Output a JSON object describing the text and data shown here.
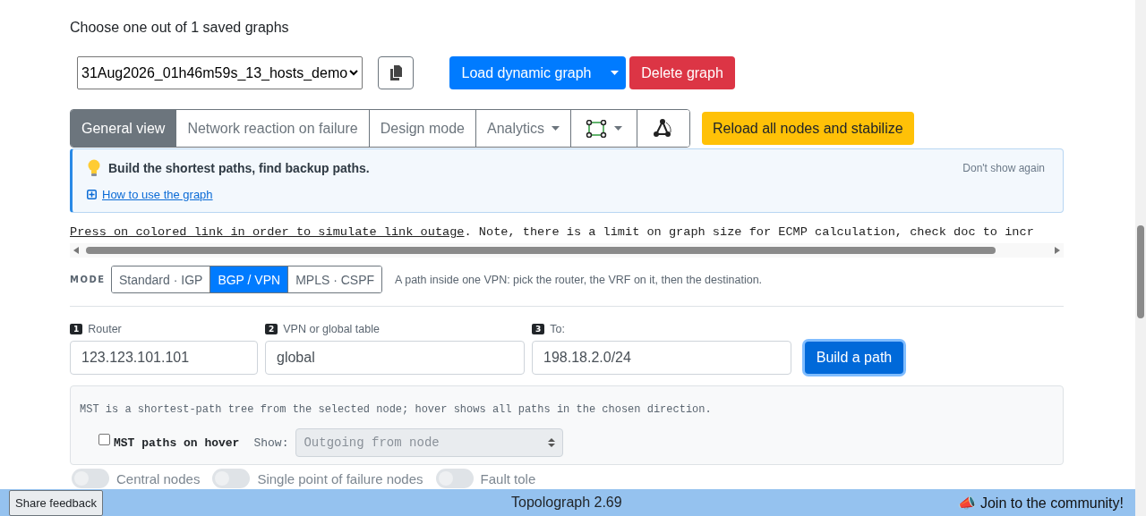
{
  "heading": "Choose one out of 1 saved graphs",
  "graph_select": {
    "value": "31Aug2026_01h46m59s_13_hosts_demo"
  },
  "load_button": {
    "label": "Load dynamic graph"
  },
  "delete_button": {
    "label": "Delete graph"
  },
  "view_tabs": [
    {
      "kind": "text",
      "label": "General view",
      "selected": true
    },
    {
      "kind": "text",
      "label": "Network reaction on failure",
      "selected": false
    },
    {
      "kind": "text",
      "label": "Design mode",
      "selected": false
    },
    {
      "kind": "dropdown",
      "label": "Analytics",
      "selected": false
    },
    {
      "kind": "square-icon",
      "selected": false
    },
    {
      "kind": "triangle-icon",
      "selected": false
    }
  ],
  "reload_button": {
    "label": "Reload all nodes and stabilize"
  },
  "tip": {
    "title": "Build the shortest paths, find backup paths.",
    "dismiss": "Don't show again",
    "link": "How to use the graph"
  },
  "hint_line": {
    "link": "Press on colored link in order to simulate link outage",
    "text": ". Note, there is a limit on graph size for ECMP calculation, check doc to incr"
  },
  "mode": {
    "label": "MODE",
    "options": [
      {
        "label": "Standard · IGP",
        "selected": false
      },
      {
        "label": "BGP / VPN",
        "selected": true
      },
      {
        "label": "MPLS · CSPF",
        "selected": false
      }
    ],
    "description": "A path inside one VPN: pick the router, the VRF on it, then the destination."
  },
  "path_fields": [
    {
      "step": "1",
      "label": "Router",
      "value": "123.123.101.101"
    },
    {
      "step": "2",
      "label": "VPN or global table",
      "value": "global"
    },
    {
      "step": "3",
      "label": "To:",
      "value": "198.18.2.0/24"
    }
  ],
  "build_button": {
    "label": "Build a path"
  },
  "mst": {
    "description": "MST is a shortest-path tree from the selected node; hover shows all paths in the chosen direction.",
    "checkbox": {
      "label": "MST paths on hover",
      "checked": false
    },
    "show_label": "Show:",
    "show_value": "Outgoing from node"
  },
  "toggles": [
    {
      "label": "Central nodes",
      "on": false
    },
    {
      "label": "Single point of failure nodes",
      "on": false
    },
    {
      "label": "Fault tole",
      "on": false
    }
  ],
  "footer": {
    "feedback": "Share feedback",
    "version": "Topolograph 2.69",
    "community": "📣 Join to the community!"
  }
}
